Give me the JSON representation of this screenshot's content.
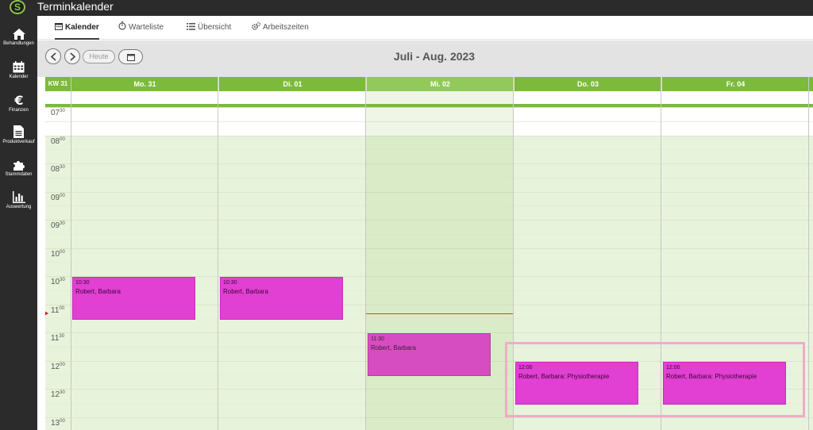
{
  "app": {
    "logo_letter": "S",
    "title": "Terminkalender"
  },
  "sidebar": {
    "items": [
      {
        "label": "Behandlungen",
        "icon": "home-icon"
      },
      {
        "label": "Kalender",
        "icon": "calendar-icon"
      },
      {
        "label": "Finanzen",
        "icon": "euro-icon"
      },
      {
        "label": "Produktverkauf",
        "icon": "document-icon"
      },
      {
        "label": "Stammdaten",
        "icon": "puzzle-icon"
      },
      {
        "label": "Auswertung",
        "icon": "bar-chart-icon"
      }
    ]
  },
  "tabs": [
    {
      "label": "Kalender",
      "icon": "calendar-icon",
      "active": true
    },
    {
      "label": "Warteliste",
      "icon": "stopwatch-icon",
      "active": false
    },
    {
      "label": "Übersicht",
      "icon": "list-icon",
      "active": false
    },
    {
      "label": "Arbeitszeiten",
      "icon": "gears-icon",
      "active": false
    }
  ],
  "toolbar": {
    "prev_icon": "chevron-left-icon",
    "next_icon": "chevron-right-icon",
    "today_label": "Heute",
    "datepicker_icon": "calendar-icon",
    "range_title": "Juli - Aug. 2023"
  },
  "calendar": {
    "week_label": "KW 31",
    "today_index": 2,
    "days": [
      "Mo. 31",
      "Di. 01",
      "Mi. 02",
      "Do. 03",
      "Fr. 04"
    ],
    "time_labels": [
      {
        "hour": "07",
        "minute": "30"
      },
      {
        "hour": "08",
        "minute": "00"
      },
      {
        "hour": "08",
        "minute": "30"
      },
      {
        "hour": "09",
        "minute": "00"
      },
      {
        "hour": "09",
        "minute": "30"
      },
      {
        "hour": "10",
        "minute": "00"
      },
      {
        "hour": "10",
        "minute": "30"
      },
      {
        "hour": "11",
        "minute": "00"
      },
      {
        "hour": "11",
        "minute": "30"
      },
      {
        "hour": "12",
        "minute": "00"
      },
      {
        "hour": "12",
        "minute": "30"
      },
      {
        "hour": "13",
        "minute": "00"
      }
    ],
    "current_time": "11:10",
    "events": [
      {
        "day": 0,
        "start": "10:30",
        "end": "11:15",
        "time": "10:30",
        "title": "Robert, Barbara"
      },
      {
        "day": 1,
        "start": "10:30",
        "end": "11:15",
        "time": "10:30",
        "title": "Robert, Barbara"
      },
      {
        "day": 2,
        "start": "11:30",
        "end": "12:15",
        "time": "11:30",
        "title": "Robert, Barbara"
      },
      {
        "day": 3,
        "start": "12:00",
        "end": "12:45",
        "time": "12:00",
        "title": "Robert, Barbara: Physiotherapie"
      },
      {
        "day": 4,
        "start": "12:00",
        "end": "12:45",
        "time": "12:00",
        "title": "Robert, Barbara: Physiotherapie"
      }
    ],
    "colors": {
      "header_green": "#7cba3c",
      "working_hours": "#e8f3dc",
      "event_magenta": "#e23fd3",
      "now_line": "#d33c2c",
      "highlight_pink": "#f3a9c9"
    }
  }
}
